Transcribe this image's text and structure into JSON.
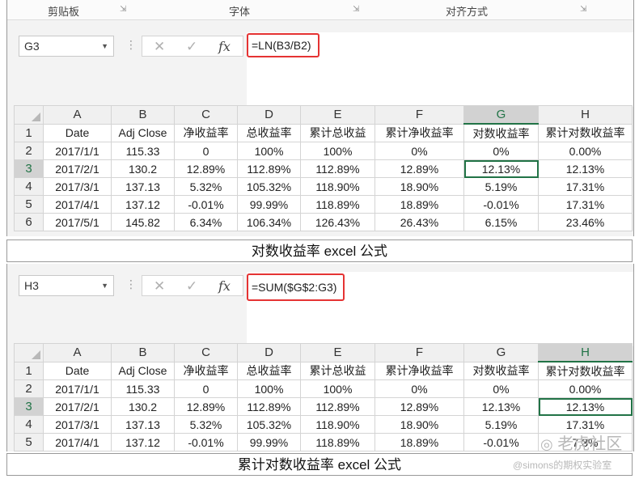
{
  "ribbon": {
    "group_clipboard": "剪贴板",
    "group_font": "字体",
    "group_alignment": "对齐方式"
  },
  "formula_buttons": {
    "cancel": "✕",
    "enter": "✓",
    "fx": "fx"
  },
  "columns": [
    "A",
    "B",
    "C",
    "D",
    "E",
    "F",
    "G",
    "H"
  ],
  "sheet1": {
    "name_box": "G3",
    "formula": "=LN(B3/B2)",
    "selected_col": "G",
    "selected_row": "3",
    "rows": [
      {
        "num": "1",
        "cells": [
          "Date",
          "Adj Close",
          "净收益率",
          "总收益率",
          "累计总收益",
          "累计净收益率",
          "对数收益率",
          "累计对数收益率"
        ]
      },
      {
        "num": "2",
        "cells": [
          "2017/1/1",
          "115.33",
          "0",
          "100%",
          "100%",
          "0%",
          "0%",
          "0.00%"
        ]
      },
      {
        "num": "3",
        "cells": [
          "2017/2/1",
          "130.2",
          "12.89%",
          "112.89%",
          "112.89%",
          "12.89%",
          "12.13%",
          "12.13%"
        ]
      },
      {
        "num": "4",
        "cells": [
          "2017/3/1",
          "137.13",
          "5.32%",
          "105.32%",
          "118.90%",
          "18.90%",
          "5.19%",
          "17.31%"
        ]
      },
      {
        "num": "5",
        "cells": [
          "2017/4/1",
          "137.12",
          "-0.01%",
          "99.99%",
          "118.89%",
          "18.89%",
          "-0.01%",
          "17.31%"
        ]
      },
      {
        "num": "6",
        "cells": [
          "2017/5/1",
          "145.82",
          "6.34%",
          "106.34%",
          "126.43%",
          "26.43%",
          "6.15%",
          "23.46%"
        ]
      }
    ],
    "caption": "对数收益率 excel 公式"
  },
  "sheet2": {
    "name_box": "H3",
    "formula": "=SUM($G$2:G3)",
    "selected_col": "H",
    "selected_row": "3",
    "rows": [
      {
        "num": "1",
        "cells": [
          "Date",
          "Adj Close",
          "净收益率",
          "总收益率",
          "累计总收益",
          "累计净收益率",
          "对数收益率",
          "累计对数收益率"
        ]
      },
      {
        "num": "2",
        "cells": [
          "2017/1/1",
          "115.33",
          "0",
          "100%",
          "100%",
          "0%",
          "0%",
          "0.00%"
        ]
      },
      {
        "num": "3",
        "cells": [
          "2017/2/1",
          "130.2",
          "12.89%",
          "112.89%",
          "112.89%",
          "12.89%",
          "12.13%",
          "12.13%"
        ]
      },
      {
        "num": "4",
        "cells": [
          "2017/3/1",
          "137.13",
          "5.32%",
          "105.32%",
          "118.90%",
          "18.90%",
          "5.19%",
          "17.31%"
        ]
      },
      {
        "num": "5",
        "cells": [
          "2017/4/1",
          "137.12",
          "-0.01%",
          "99.99%",
          "118.89%",
          "18.89%",
          "-0.01%",
          "7.3%"
        ]
      }
    ],
    "caption": "累计对数收益率 excel 公式"
  },
  "watermark": {
    "brand": "老虎社区",
    "credit": "@simons的期权实验室"
  }
}
